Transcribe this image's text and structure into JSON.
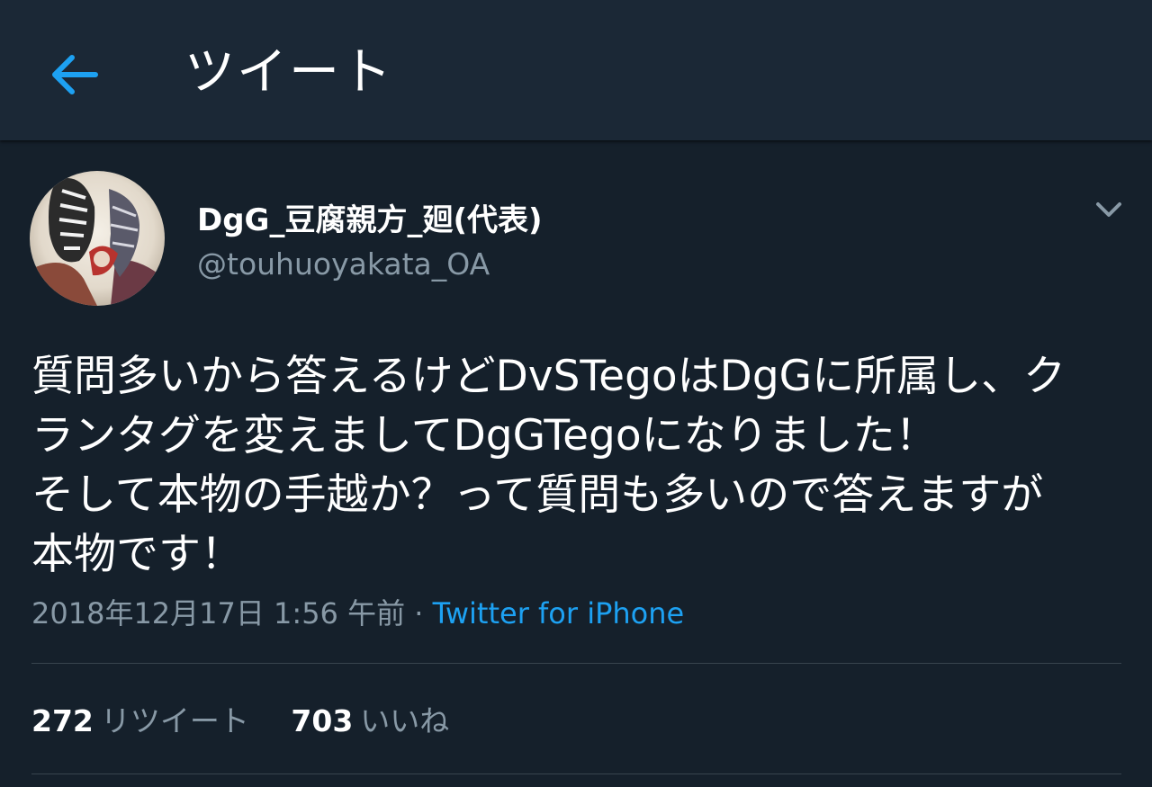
{
  "header": {
    "title": "ツイート",
    "back_icon": "arrow-left-icon"
  },
  "colors": {
    "background": "#15202b",
    "header_bg": "#1b2836",
    "accent": "#1da1f2",
    "muted": "#8899a6",
    "divider": "#38444d"
  },
  "tweet": {
    "author": {
      "display_name": "DgG_豆腐親方_廻(代表)",
      "handle": "@touhuoyakata_OA"
    },
    "text_lines": [
      "質問多いから答えるけどDvSTegoはDgGに所属し、ク",
      "ランタグを変えましてDgGTegoになりました！",
      "そして本物の手越か？って質問も多いので答えますが",
      "本物です！"
    ],
    "timestamp": "2018年12月17日 1:56 午前",
    "separator": " · ",
    "source": "Twitter for iPhone",
    "stats": {
      "retweets": {
        "count": "272",
        "label": "リツイート"
      },
      "likes": {
        "count": "703",
        "label": "いいね"
      }
    }
  }
}
